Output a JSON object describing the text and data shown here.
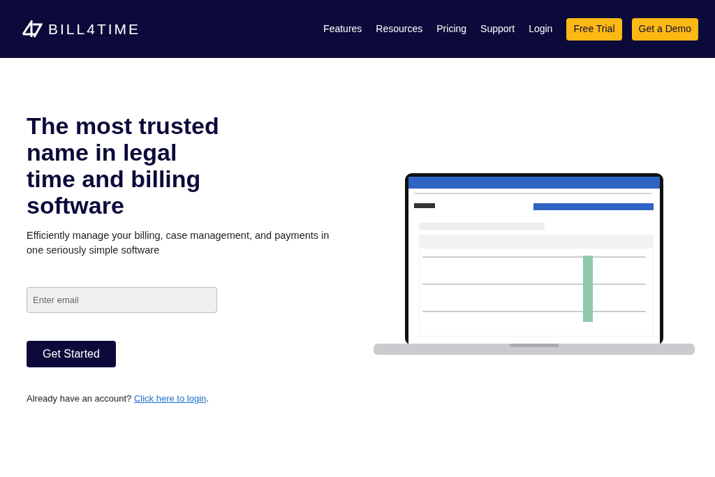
{
  "header": {
    "brand": "BILL4TIME",
    "nav": [
      "Features",
      "Resources",
      "Pricing",
      "Support",
      "Login"
    ],
    "buttons": [
      "Free Trial",
      "Get a Demo"
    ]
  },
  "hero": {
    "title": "The most trusted name in legal time and billing software",
    "subtitle": "Efficiently manage your billing, case management, and payments in one seriously simple software",
    "email": {
      "placeholder": "Enter email"
    },
    "cta": "Get Started",
    "login_prompt": "Already have an account?",
    "login_link": "Click here to login",
    "login_end": "."
  }
}
